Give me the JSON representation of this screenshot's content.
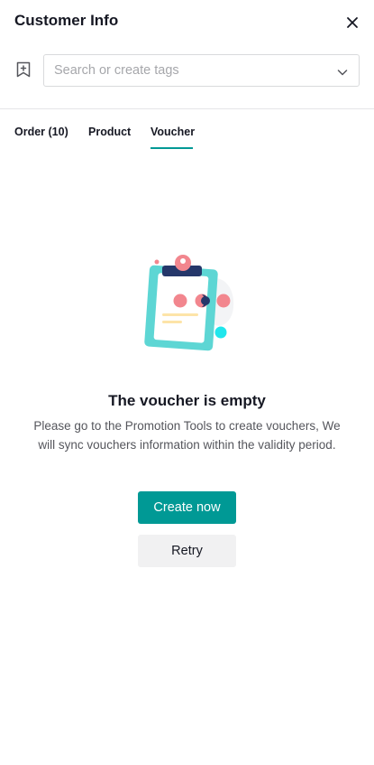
{
  "header": {
    "title": "Customer Info",
    "close_icon": "close-icon"
  },
  "tags": {
    "icon": "bookmark-add-icon",
    "placeholder": "Search or create tags"
  },
  "tabs": [
    {
      "label": "Order (10)",
      "active": false
    },
    {
      "label": "Product",
      "active": false
    },
    {
      "label": "Voucher",
      "active": true
    }
  ],
  "empty_state": {
    "illustration": "clipboard-illustration",
    "title": "The voucher is empty",
    "description": "Please go to the Promotion Tools to create vouchers, We will sync vouchers information within the validity period.",
    "primary_button": "Create now",
    "secondary_button": "Retry"
  },
  "colors": {
    "accent": "#009995",
    "text_primary": "#161823",
    "text_secondary": "#55565c",
    "placeholder": "#a6a7ab",
    "illustration_teal": "#5dd6d4",
    "illustration_pink": "#f2868e",
    "illustration_navy": "#25376a",
    "illustration_cyan": "#20e6ec"
  }
}
